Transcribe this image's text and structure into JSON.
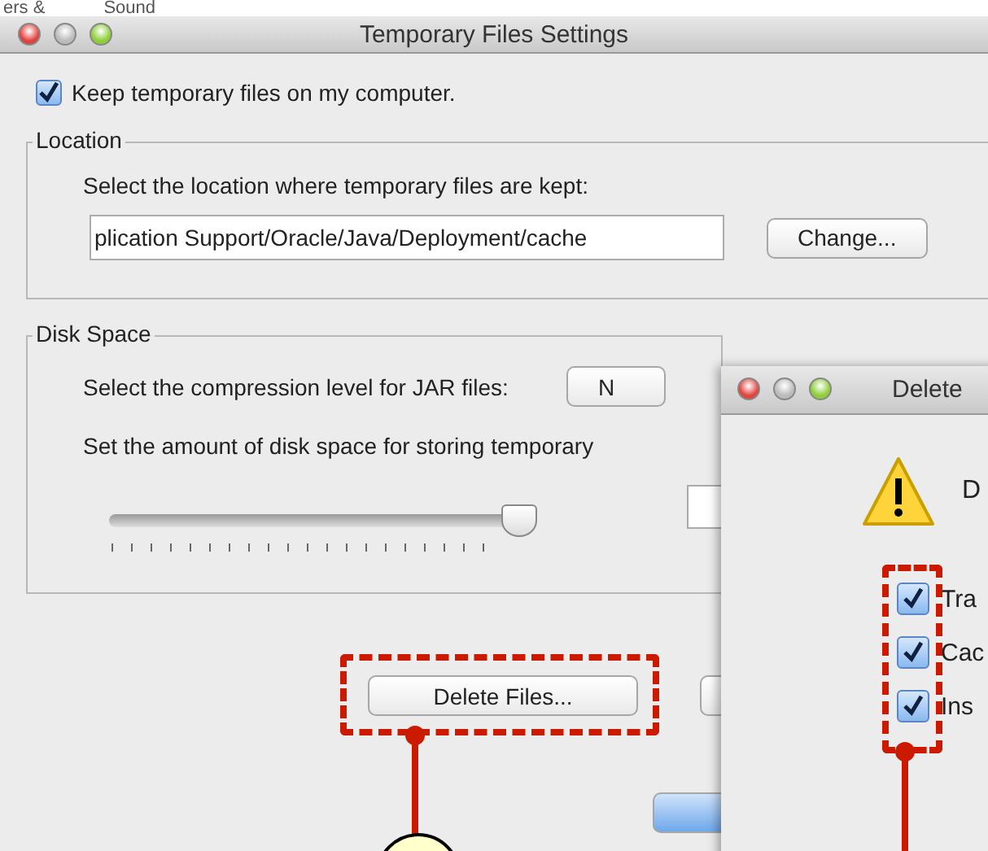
{
  "background_tabs": [
    "ers &",
    "Sound"
  ],
  "window": {
    "title": "Temporary Files Settings"
  },
  "keep_files": {
    "label": "Keep temporary files on my computer.",
    "checked": true
  },
  "location": {
    "legend": "Location",
    "description": "Select the location where temporary files are kept:",
    "path": "plication Support/Oracle/Java/Deployment/cache",
    "button": "Change..."
  },
  "disk_space": {
    "legend": "Disk Space",
    "compression_label": "Select the compression level for JAR files:",
    "compression_value": "N",
    "amount_label": "Set the amount of disk space for storing temporary",
    "slider": {
      "level": 0.96
    }
  },
  "buttons": {
    "delete": "Delete Files..."
  },
  "dialog": {
    "title": "Delete",
    "message": "D",
    "options": [
      {
        "label": "Tra",
        "checked": true
      },
      {
        "label": "Cac",
        "checked": true
      },
      {
        "label": "Ins",
        "checked": true
      }
    ]
  }
}
